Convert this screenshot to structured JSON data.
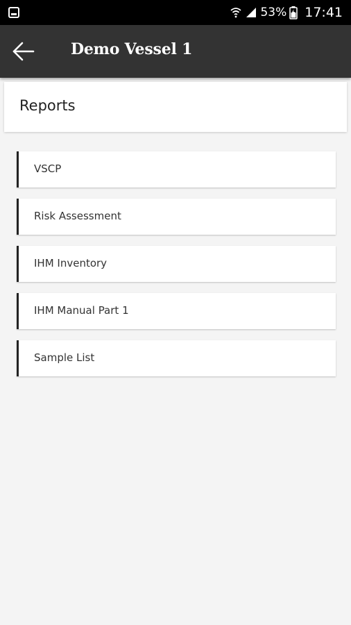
{
  "status_bar": {
    "battery": "53%",
    "time": "17:41"
  },
  "app_bar": {
    "title": "Demo Vessel 1"
  },
  "section": {
    "title": "Reports"
  },
  "reports": [
    {
      "label": "VSCP"
    },
    {
      "label": "Risk Assessment"
    },
    {
      "label": "IHM Inventory"
    },
    {
      "label": "IHM Manual Part 1"
    },
    {
      "label": "Sample List"
    }
  ]
}
